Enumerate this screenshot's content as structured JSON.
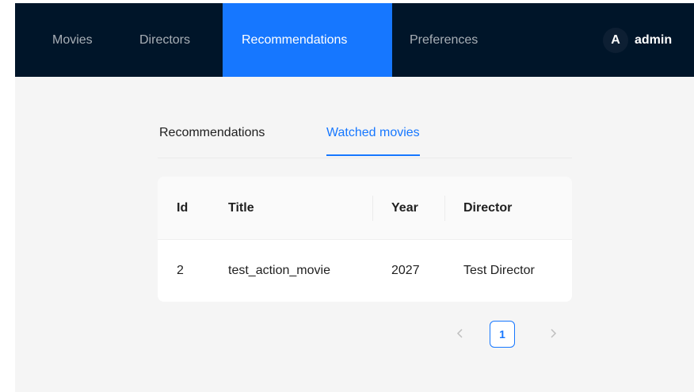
{
  "nav": {
    "items": [
      {
        "label": "Movies"
      },
      {
        "label": "Directors"
      },
      {
        "label": "Recommendations",
        "active": true
      },
      {
        "label": "Preferences"
      }
    ],
    "user": {
      "avatar_letter": "A",
      "name": "admin"
    }
  },
  "tabs": [
    {
      "label": "Recommendations"
    },
    {
      "label": "Watched movies",
      "active": true
    }
  ],
  "table": {
    "columns": [
      "Id",
      "Title",
      "Year",
      "Director"
    ],
    "rows": [
      [
        "2",
        "test_action_movie",
        "2027",
        "Test Director"
      ]
    ]
  },
  "pagination": {
    "current_page": "1"
  },
  "colors": {
    "nav_bg": "#001529",
    "accent": "#1677ff",
    "page_bg": "#f5f5f5"
  }
}
